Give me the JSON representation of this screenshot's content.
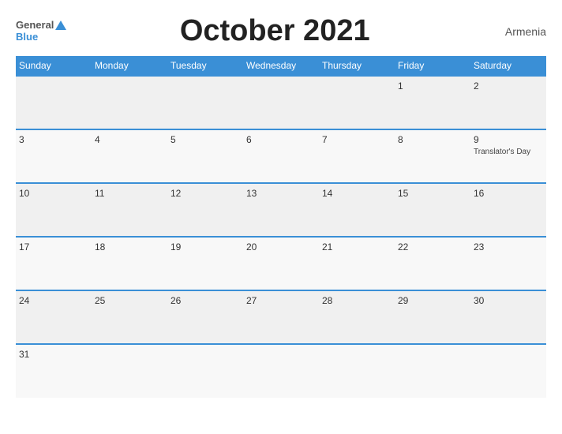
{
  "header": {
    "logo_general": "General",
    "logo_blue": "Blue",
    "title": "October 2021",
    "country": "Armenia"
  },
  "days_of_week": [
    "Sunday",
    "Monday",
    "Tuesday",
    "Wednesday",
    "Thursday",
    "Friday",
    "Saturday"
  ],
  "weeks": [
    [
      {
        "day": "",
        "holiday": ""
      },
      {
        "day": "",
        "holiday": ""
      },
      {
        "day": "",
        "holiday": ""
      },
      {
        "day": "",
        "holiday": ""
      },
      {
        "day": "",
        "holiday": ""
      },
      {
        "day": "1",
        "holiday": ""
      },
      {
        "day": "2",
        "holiday": ""
      }
    ],
    [
      {
        "day": "3",
        "holiday": ""
      },
      {
        "day": "4",
        "holiday": ""
      },
      {
        "day": "5",
        "holiday": ""
      },
      {
        "day": "6",
        "holiday": ""
      },
      {
        "day": "7",
        "holiday": ""
      },
      {
        "day": "8",
        "holiday": ""
      },
      {
        "day": "9",
        "holiday": "Translator's Day"
      }
    ],
    [
      {
        "day": "10",
        "holiday": ""
      },
      {
        "day": "11",
        "holiday": ""
      },
      {
        "day": "12",
        "holiday": ""
      },
      {
        "day": "13",
        "holiday": ""
      },
      {
        "day": "14",
        "holiday": ""
      },
      {
        "day": "15",
        "holiday": ""
      },
      {
        "day": "16",
        "holiday": ""
      }
    ],
    [
      {
        "day": "17",
        "holiday": ""
      },
      {
        "day": "18",
        "holiday": ""
      },
      {
        "day": "19",
        "holiday": ""
      },
      {
        "day": "20",
        "holiday": ""
      },
      {
        "day": "21",
        "holiday": ""
      },
      {
        "day": "22",
        "holiday": ""
      },
      {
        "day": "23",
        "holiday": ""
      }
    ],
    [
      {
        "day": "24",
        "holiday": ""
      },
      {
        "day": "25",
        "holiday": ""
      },
      {
        "day": "26",
        "holiday": ""
      },
      {
        "day": "27",
        "holiday": ""
      },
      {
        "day": "28",
        "holiday": ""
      },
      {
        "day": "29",
        "holiday": ""
      },
      {
        "day": "30",
        "holiday": ""
      }
    ],
    [
      {
        "day": "31",
        "holiday": ""
      },
      {
        "day": "",
        "holiday": ""
      },
      {
        "day": "",
        "holiday": ""
      },
      {
        "day": "",
        "holiday": ""
      },
      {
        "day": "",
        "holiday": ""
      },
      {
        "day": "",
        "holiday": ""
      },
      {
        "day": "",
        "holiday": ""
      }
    ]
  ]
}
